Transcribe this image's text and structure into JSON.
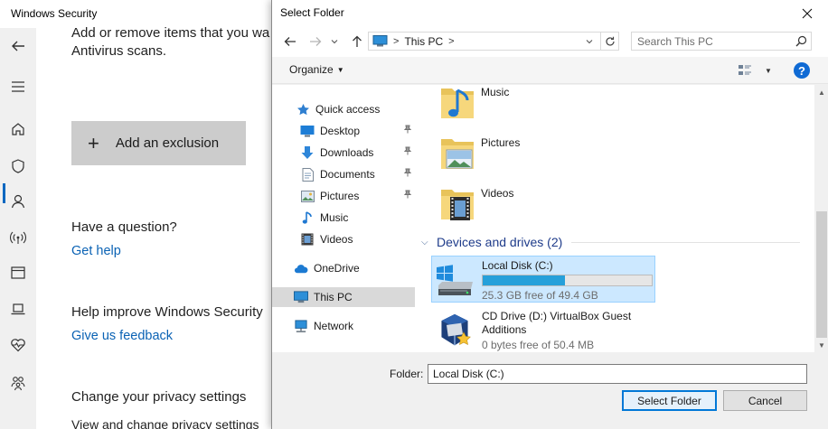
{
  "background_window": {
    "title": "Windows Security",
    "lines": {
      "add_remove_1": "Add or remove items that you wa",
      "add_remove_2": "Antivirus scans.",
      "question_heading": "Have a question?",
      "improve_heading": "Help improve Windows Security",
      "privacy_heading": "Change your privacy settings",
      "privacy_sub": "View and change privacy settings"
    },
    "add_exclusion_button": {
      "plus": "+",
      "label": "Add an exclusion"
    },
    "links": {
      "get_help": "Get help",
      "feedback": "Give us feedback"
    },
    "rail_icons": [
      "back-arrow-icon",
      "hamburger-menu-icon",
      "home-icon",
      "shield-icon",
      "person-icon",
      "wireless-icon",
      "browser-window-icon",
      "laptop-icon",
      "heart-monitor-icon",
      "family-icon"
    ],
    "accent_color": "#0067c0"
  },
  "dialog": {
    "title": "Select Folder",
    "close_glyph": "✕",
    "address": {
      "location": "This PC",
      "separator": ">"
    },
    "search": {
      "placeholder": "Search This PC",
      "value": ""
    },
    "toolbar": {
      "organize": "Organize",
      "organize_caret": "▼",
      "view_caret": "▼",
      "help_glyph": "?"
    },
    "nav_pane": {
      "quick_access": "Quick access",
      "pinned": [
        {
          "label": "Desktop",
          "icon": "desktop-icon"
        },
        {
          "label": "Downloads",
          "icon": "downloads-icon"
        },
        {
          "label": "Documents",
          "icon": "documents-icon"
        },
        {
          "label": "Pictures",
          "icon": "pictures-icon"
        }
      ],
      "unpinned": [
        {
          "label": "Music",
          "icon": "music-icon"
        },
        {
          "label": "Videos",
          "icon": "videos-icon"
        }
      ],
      "onedrive": "OneDrive",
      "this_pc": "This PC",
      "network": "Network",
      "pin_glyph": "📌"
    },
    "content": {
      "folders": [
        {
          "name": "Music",
          "icon": "music-folder-icon"
        },
        {
          "name": "Pictures",
          "icon": "pictures-folder-icon"
        },
        {
          "name": "Videos",
          "icon": "videos-folder-icon"
        }
      ],
      "group_header": "Devices and drives (2)",
      "group_chevron": "⌵",
      "drives": [
        {
          "name": "Local Disk (C:)",
          "free": "25.3 GB free of 49.4 GB",
          "used_fraction": 0.488
        },
        {
          "name": "CD Drive (D:) VirtualBox Guest Additions",
          "free": "0 bytes free of 50.4 MB"
        }
      ]
    },
    "scrollbar": {
      "up": "▲",
      "down": "▼"
    },
    "folder_field": {
      "label": "Folder:",
      "value": "Local Disk (C:)"
    },
    "buttons": {
      "select": "Select Folder",
      "cancel": "Cancel"
    },
    "colors": {
      "selection": "#cce8ff",
      "drive_bar": "#26a0da",
      "group_header": "#1e3b8a",
      "help": "#0f6ad4"
    }
  }
}
